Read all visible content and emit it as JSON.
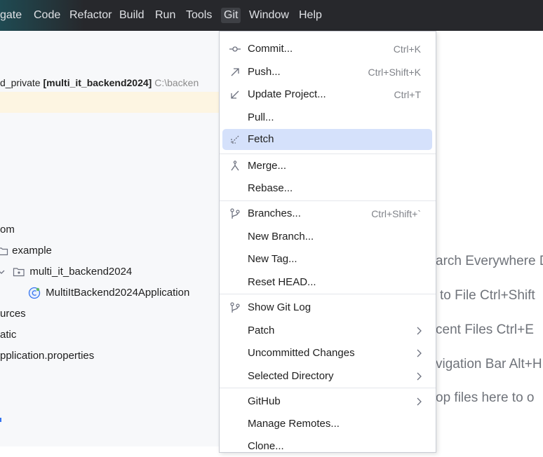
{
  "menubar": {
    "items": [
      {
        "label": "gate"
      },
      {
        "label": "Code"
      },
      {
        "label": "Refactor"
      },
      {
        "label": "Build"
      },
      {
        "label": "Run"
      },
      {
        "label": "Tools"
      },
      {
        "label": "Git"
      },
      {
        "label": "Window"
      },
      {
        "label": "Help"
      }
    ]
  },
  "breadcrumb": {
    "prefix": "d_private",
    "project": "[multi_it_backend2024]",
    "path": "C:\\backen"
  },
  "tree": {
    "items": [
      {
        "label": "om"
      },
      {
        "label": "example"
      },
      {
        "label": "multi_it_backend2024"
      },
      {
        "label": "MultiItBackend2024Application"
      },
      {
        "label": "urces"
      },
      {
        "label": "atic"
      },
      {
        "label": "pplication.properties"
      }
    ]
  },
  "hints": {
    "items": [
      {
        "text": "arch Everywhere D"
      },
      {
        "text": "to File Ctrl+Shift"
      },
      {
        "text": "cent Files Ctrl+E"
      },
      {
        "text": "vigation Bar Alt+H"
      },
      {
        "text": "op files here to o"
      }
    ]
  },
  "git_menu": {
    "items": [
      {
        "label": "Commit...",
        "shortcut": "Ctrl+K",
        "icon": "commit-icon"
      },
      {
        "label": "Push...",
        "shortcut": "Ctrl+Shift+K",
        "icon": "push-icon"
      },
      {
        "label": "Update Project...",
        "shortcut": "Ctrl+T",
        "icon": "update-icon"
      },
      {
        "label": "Pull...",
        "shortcut": "",
        "icon": ""
      },
      {
        "label": "Fetch",
        "shortcut": "",
        "icon": "fetch-icon"
      },
      {
        "label": "Merge...",
        "shortcut": "",
        "icon": "merge-icon"
      },
      {
        "label": "Rebase...",
        "shortcut": "",
        "icon": ""
      },
      {
        "label": "Branches...",
        "shortcut": "Ctrl+Shift+`",
        "icon": "branch-icon"
      },
      {
        "label": "New Branch...",
        "shortcut": "",
        "icon": ""
      },
      {
        "label": "New Tag...",
        "shortcut": "",
        "icon": ""
      },
      {
        "label": "Reset HEAD...",
        "shortcut": "",
        "icon": ""
      },
      {
        "label": "Show Git Log",
        "shortcut": "",
        "icon": "git-log-icon"
      },
      {
        "label": "Patch",
        "shortcut": "",
        "icon": ""
      },
      {
        "label": "Uncommitted Changes",
        "shortcut": "",
        "icon": ""
      },
      {
        "label": "Selected Directory",
        "shortcut": "",
        "icon": ""
      },
      {
        "label": "GitHub",
        "shortcut": "",
        "icon": ""
      },
      {
        "label": "Manage Remotes...",
        "shortcut": "",
        "icon": ""
      },
      {
        "label": "Clone...",
        "shortcut": "",
        "icon": ""
      }
    ],
    "selected": "Fetch"
  }
}
